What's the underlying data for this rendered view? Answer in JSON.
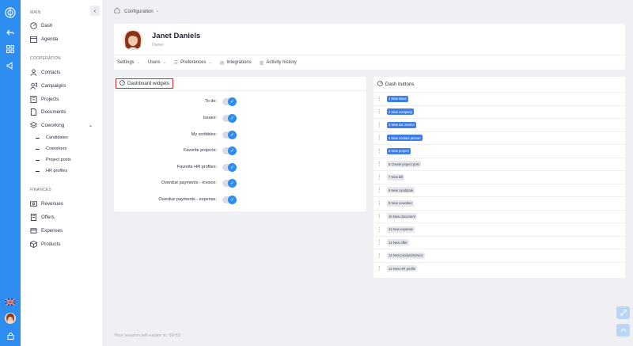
{
  "rail": {
    "logo_icon": "app-logo-icon",
    "back_icon": "back-arrow-icon",
    "grid_icon": "grid-icon",
    "speaker_icon": "megaphone-icon",
    "flag_icon": "uk-flag-icon",
    "avatar_icon": "user-avatar-icon",
    "lock_icon": "lock-icon"
  },
  "sidebar": {
    "main_title": "MAIN",
    "main_items": [
      {
        "label": "Dash",
        "icon": "gauge-icon"
      },
      {
        "label": "Agenda",
        "icon": "calendar-icon"
      }
    ],
    "cooperation_title": "COOPERATION",
    "cooperation_items": [
      {
        "label": "Contacts",
        "icon": "contacts-icon"
      },
      {
        "label": "Campaigns",
        "icon": "campaigns-icon"
      },
      {
        "label": "Projects",
        "icon": "projects-icon"
      },
      {
        "label": "Documents",
        "icon": "documents-icon"
      },
      {
        "label": "Coworking",
        "icon": "coworking-icon"
      }
    ],
    "coworking_sub": [
      "Candidates",
      "Coworkers",
      "Project posts",
      "HR profiles"
    ],
    "finances_title": "FINANCES",
    "finances_items": [
      {
        "label": "Revenues",
        "icon": "revenues-icon"
      },
      {
        "label": "Offers",
        "icon": "offers-icon"
      },
      {
        "label": "Expenses",
        "icon": "expenses-icon"
      },
      {
        "label": "Products",
        "icon": "products-icon"
      }
    ]
  },
  "breadcrumb": {
    "label": "Configuration"
  },
  "profile": {
    "name": "Janet Daniels",
    "role": "Owner",
    "tabs": [
      {
        "label": "Settings",
        "dropdown": true
      },
      {
        "label": "Users",
        "dropdown": true
      },
      {
        "label": "Preferences",
        "dropdown": true
      },
      {
        "label": "Integrations",
        "dropdown": false
      },
      {
        "label": "Activity history",
        "dropdown": false
      }
    ]
  },
  "widgets": {
    "title": "Dashboard widgets",
    "items": [
      {
        "label": "To do:",
        "on": true
      },
      {
        "label": "Issues:",
        "on": true
      },
      {
        "label": "My scribbles:",
        "on": true
      },
      {
        "label": "Favorite projects:",
        "on": true
      },
      {
        "label": "Favorite HR profiles:",
        "on": true
      },
      {
        "label": "Overdue payments - invoice:",
        "on": true
      },
      {
        "label": "Overdue payments - expense:",
        "on": true
      }
    ]
  },
  "dash_buttons": {
    "title": "Dash buttons",
    "items": [
      {
        "label": "1 New issue",
        "active": true
      },
      {
        "label": "2 New company",
        "active": true
      },
      {
        "label": "3 New tax invoice",
        "active": true
      },
      {
        "label": "4 New contact person",
        "active": true
      },
      {
        "label": "5 New project",
        "active": true
      },
      {
        "label": "6 Create project post",
        "active": false
      },
      {
        "label": "7 New bill",
        "active": false
      },
      {
        "label": "8 New candidate",
        "active": false
      },
      {
        "label": "9 New coworker",
        "active": false
      },
      {
        "label": "10 New document",
        "active": false
      },
      {
        "label": "11 New expense",
        "active": false
      },
      {
        "label": "12 New offer",
        "active": false
      },
      {
        "label": "13 New product/service",
        "active": false
      },
      {
        "label": "14 New HR profile",
        "active": false
      }
    ]
  },
  "session_text": "Your session will expire in: 59:53",
  "colors": {
    "primary": "#2d8ef0",
    "chip_active": "#3f7ee8",
    "highlight": "#e0242a"
  }
}
